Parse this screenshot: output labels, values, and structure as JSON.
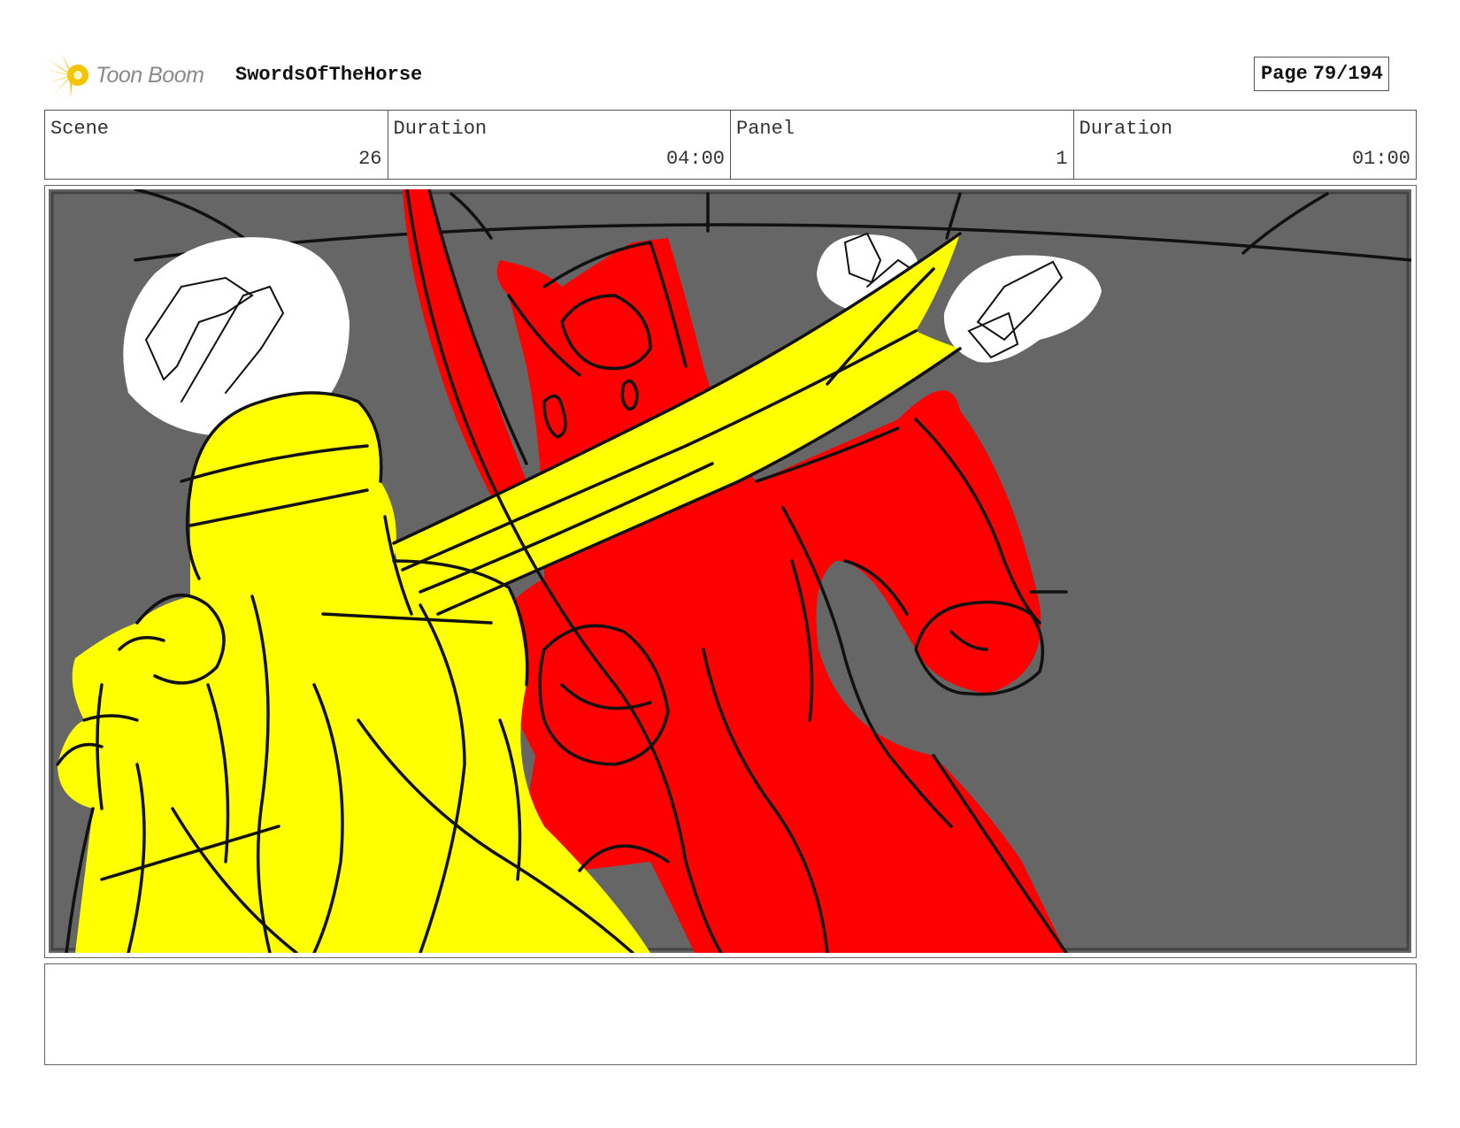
{
  "header": {
    "logo_text": "Toon Boom",
    "project_title": "SwordsOfTheHorse",
    "page_label": "Page",
    "page_number": "79/194"
  },
  "info": {
    "scene_label": "Scene",
    "scene_value": "26",
    "scene_duration_label": "Duration",
    "scene_duration_value": "04:00",
    "panel_label": "Panel",
    "panel_value": "1",
    "panel_duration_label": "Duration",
    "panel_duration_value": "01:00"
  },
  "notes": {
    "text": ""
  },
  "colors": {
    "background": "#666666",
    "yellow_character": "#ffff00",
    "red_character": "#ff0000",
    "ink": "#111111",
    "logo_accent": "#f5c400"
  }
}
